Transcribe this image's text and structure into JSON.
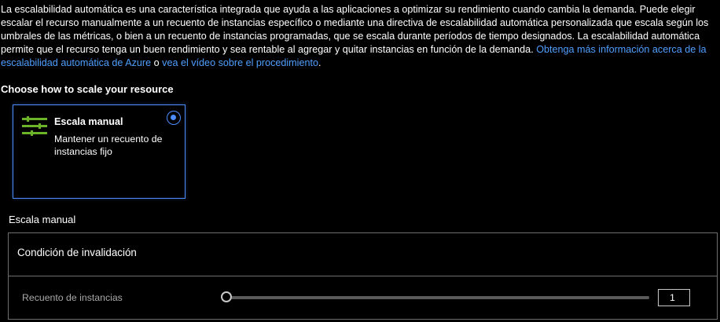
{
  "intro": {
    "text": "La escalabilidad automática es una característica integrada que ayuda a las aplicaciones a optimizar su rendimiento cuando cambia la demanda. Puede elegir escalar el recurso manualmente a un recuento de instancias específico o mediante una directiva de escalabilidad automática personalizada que escala según los umbrales de las métricas, o bien a un recuento de instancias programadas, que se escala durante períodos de tiempo designados. La escalabilidad automática permite que el recurso tenga un buen rendimiento y sea rentable al agregar y quitar instancias en función de la demanda.",
    "link_learn_more": "Obtenga más información acerca de la escalabilidad automática de Azure",
    "connector": "o",
    "link_video": "vea el vídeo sobre el procedimiento",
    "end": "."
  },
  "section_title": "Choose how to scale your resource",
  "scale_option": {
    "title": "Escala manual",
    "description": "Mantener un recuento de instancias fijo",
    "selected": true,
    "icon": "sliders-icon",
    "icon_color": "#6bb42a"
  },
  "manual_section_label": "Escala manual",
  "override_panel": {
    "title": "Condición de invalidación",
    "instance_count_label": "Recuento de instancias",
    "instance_count_value": "1",
    "slider_fraction": 0
  },
  "colors": {
    "accent": "#4b8cff",
    "link": "#4f9fff",
    "border": "#6e6e6e"
  }
}
